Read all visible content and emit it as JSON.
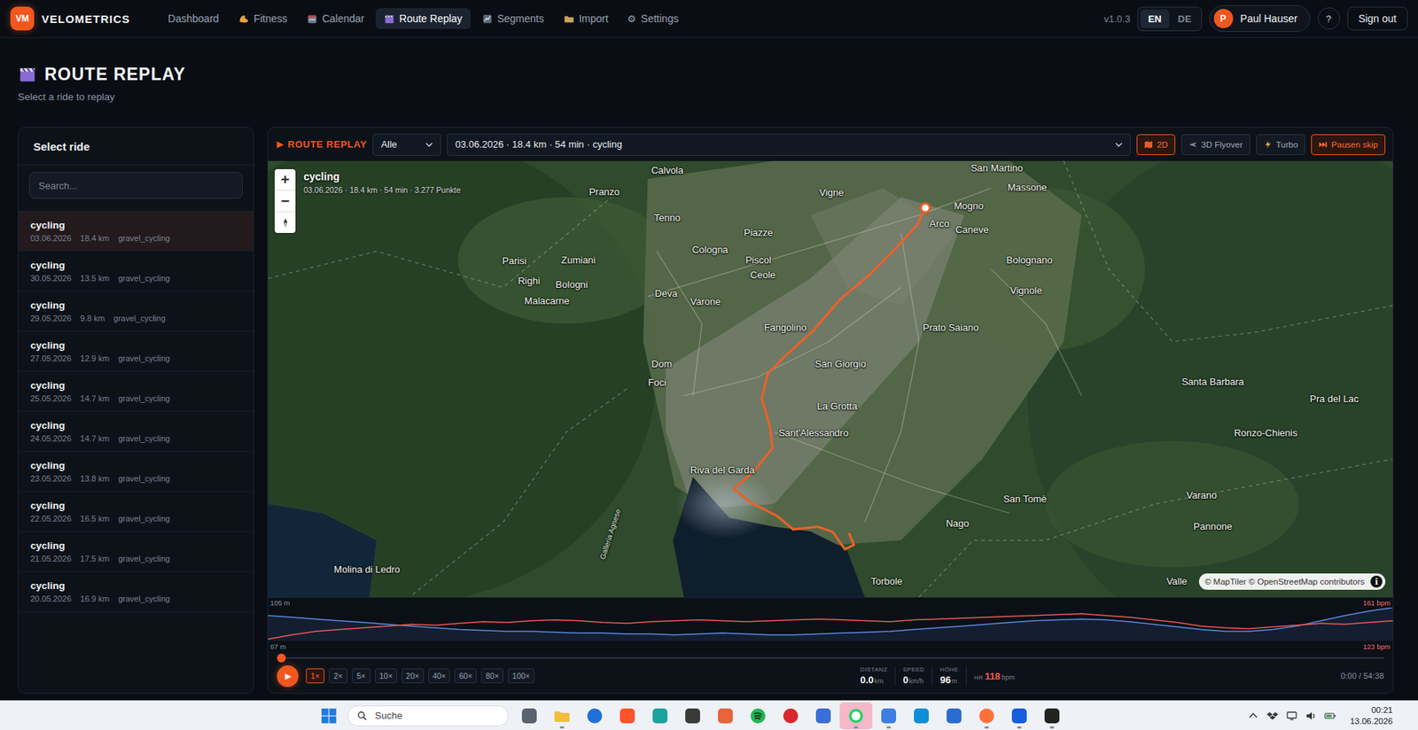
{
  "app": {
    "logo": "VM",
    "name": "VELOMETRICS",
    "version": "v1.0.3"
  },
  "nav": [
    {
      "label": "Dashboard",
      "glyph": "",
      "selected": false
    },
    {
      "label": "Fitness",
      "glyph": "",
      "selected": false
    },
    {
      "label": "Calendar",
      "glyph": "",
      "selected": false
    },
    {
      "label": "Route Replay",
      "glyph": "",
      "selected": true
    },
    {
      "label": "Segments",
      "glyph": "",
      "selected": false
    },
    {
      "label": "Import",
      "glyph": "",
      "selected": false
    },
    {
      "label": "Settings",
      "glyph": "⚙",
      "selected": false
    }
  ],
  "languages": [
    {
      "label": "EN",
      "selected": true
    },
    {
      "label": "DE",
      "selected": false
    }
  ],
  "user": {
    "initial": "P",
    "name": "Paul Hauser"
  },
  "help": "?",
  "sign_out": "Sign out",
  "page": {
    "title": "ROUTE REPLAY",
    "subtitle": "Select a ride to replay"
  },
  "sidebar": {
    "title": "Select ride",
    "search_placeholder": "Search...",
    "rides": [
      {
        "title": "cycling",
        "date": "03.06.2026",
        "distance": "18.4 km",
        "type": "gravel_cycling",
        "selected": true
      },
      {
        "title": "cycling",
        "date": "30.05.2026",
        "distance": "13.5 km",
        "type": "gravel_cycling",
        "selected": false
      },
      {
        "title": "cycling",
        "date": "29.05.2026",
        "distance": "9.8 km",
        "type": "gravel_cycling",
        "selected": false
      },
      {
        "title": "cycling",
        "date": "27.05.2026",
        "distance": "12.9 km",
        "type": "gravel_cycling",
        "selected": false
      },
      {
        "title": "cycling",
        "date": "25.05.2026",
        "distance": "14.7 km",
        "type": "gravel_cycling",
        "selected": false
      },
      {
        "title": "cycling",
        "date": "24.05.2026",
        "distance": "14.7 km",
        "type": "gravel_cycling",
        "selected": false
      },
      {
        "title": "cycling",
        "date": "23.05.2026",
        "distance": "13.8 km",
        "type": "gravel_cycling",
        "selected": false
      },
      {
        "title": "cycling",
        "date": "22.05.2026",
        "distance": "16.5 km",
        "type": "gravel_cycling",
        "selected": false
      },
      {
        "title": "cycling",
        "date": "21.05.2026",
        "distance": "17.5 km",
        "type": "gravel_cycling",
        "selected": false
      },
      {
        "title": "cycling",
        "date": "20.05.2026",
        "distance": "16.9 km",
        "type": "gravel_cycling",
        "selected": false
      }
    ]
  },
  "toolbar": {
    "glyph": "▶",
    "label": "ROUTE REPLAY",
    "filter": "Alle",
    "ride": "03.06.2026 · 18.4 km · 54 min · cycling",
    "modes": [
      {
        "label": "2D",
        "selected": true
      },
      {
        "label": "3D Flyover",
        "selected": false
      },
      {
        "label": "Turbo",
        "selected": false
      },
      {
        "label": "Pausen skip",
        "selected": true
      }
    ]
  },
  "map": {
    "title": "cycling",
    "meta": "03.06.2026 · 18.4 km · 54 min · 3.277 Punkte",
    "zoom_in": "+",
    "zoom_out": "−",
    "attribution": "© MapTiler © OpenStreetMap contributors",
    "info": "i",
    "places": [
      "Calvola",
      "Pranzo",
      "Vigne",
      "San Martino",
      "Massone",
      "Mogno",
      "Arco",
      "Caneve",
      "Tenno",
      "Piazze",
      "Cologna",
      "Piscol",
      "Ceole",
      "Parisi",
      "Zumiani",
      "Righi",
      "Bologni",
      "Malacarne",
      "Bolognano",
      "Deva",
      "Varone",
      "Vignole",
      "Fangolino",
      "Prato Saiano",
      "Dom",
      "Foci",
      "San Giorgio",
      "Santa Barbara",
      "Pra del Lac",
      "La Grotta",
      "Sant'Alessandro",
      "Ronzo-Chienis",
      "Riva del Garda",
      "San Tomè",
      "Varano",
      "Nago",
      "Pannone",
      "Molina di Ledro",
      "Torbole",
      "Valle",
      "Galleria Agnese"
    ]
  },
  "chart": {
    "elevation_top": "105 m",
    "elevation_bottom": "67 m",
    "hr_top": "161 bpm",
    "hr_bottom": "123 bpm",
    "elevation": [
      96,
      94,
      92,
      90,
      88,
      86,
      84,
      82,
      80,
      79,
      78,
      78,
      77,
      76,
      76,
      75,
      75,
      74,
      75,
      76,
      75,
      74,
      74,
      75,
      76,
      77,
      78,
      80,
      82,
      84,
      86,
      88,
      90,
      91,
      92,
      91,
      89,
      86,
      83,
      80,
      78,
      78,
      80,
      84,
      90,
      96,
      101,
      105
    ],
    "heart_rate": [
      125,
      130,
      134,
      136,
      138,
      140,
      142,
      141,
      143,
      145,
      144,
      146,
      147,
      146,
      144,
      143,
      145,
      146,
      147,
      146,
      145,
      146,
      147,
      148,
      147,
      146,
      145,
      147,
      148,
      149,
      150,
      151,
      152,
      153,
      154,
      152,
      150,
      147,
      144,
      140,
      138,
      137,
      139,
      141,
      143,
      142,
      144,
      146
    ]
  },
  "player": {
    "play": "▶",
    "progress": 0,
    "speeds": [
      {
        "label": "1×",
        "selected": true
      },
      {
        "label": "2×",
        "selected": false
      },
      {
        "label": "5×",
        "selected": false
      },
      {
        "label": "10×",
        "selected": false
      },
      {
        "label": "20×",
        "selected": false
      },
      {
        "label": "40×",
        "selected": false
      },
      {
        "label": "60×",
        "selected": false
      },
      {
        "label": "80×",
        "selected": false
      },
      {
        "label": "100×",
        "selected": false
      }
    ],
    "stats": [
      {
        "label": "DISTANZ",
        "value": "0.0",
        "unit": "km",
        "kind": "stacked"
      },
      {
        "label": "SPEED",
        "value": "0",
        "unit": "km/h",
        "kind": "stacked"
      },
      {
        "label": "HÖHE",
        "value": "96",
        "unit": "m",
        "kind": "stacked"
      },
      {
        "label": "HR",
        "value": "118",
        "unit": "bpm",
        "kind": "inline"
      }
    ],
    "time": "0:00 / 54:38"
  },
  "taskbar": {
    "search": "Suche",
    "time": "00:21",
    "date": "13.06.2026",
    "apps": [
      {
        "highlighted": false,
        "running": false
      },
      {
        "highlighted": false,
        "running": true
      },
      {
        "highlighted": false,
        "running": false
      },
      {
        "highlighted": false,
        "running": false
      },
      {
        "highlighted": false,
        "running": false
      },
      {
        "highlighted": false,
        "running": false
      },
      {
        "highlighted": false,
        "running": false
      },
      {
        "highlighted": false,
        "running": false
      },
      {
        "highlighted": false,
        "running": false
      },
      {
        "highlighted": false,
        "running": false
      },
      {
        "highlighted": true,
        "running": true
      },
      {
        "highlighted": false,
        "running": true
      },
      {
        "highlighted": false,
        "running": false
      },
      {
        "highlighted": false,
        "running": false
      },
      {
        "highlighted": false,
        "running": true
      },
      {
        "highlighted": false,
        "running": true
      },
      {
        "highlighted": false,
        "running": true
      }
    ]
  }
}
